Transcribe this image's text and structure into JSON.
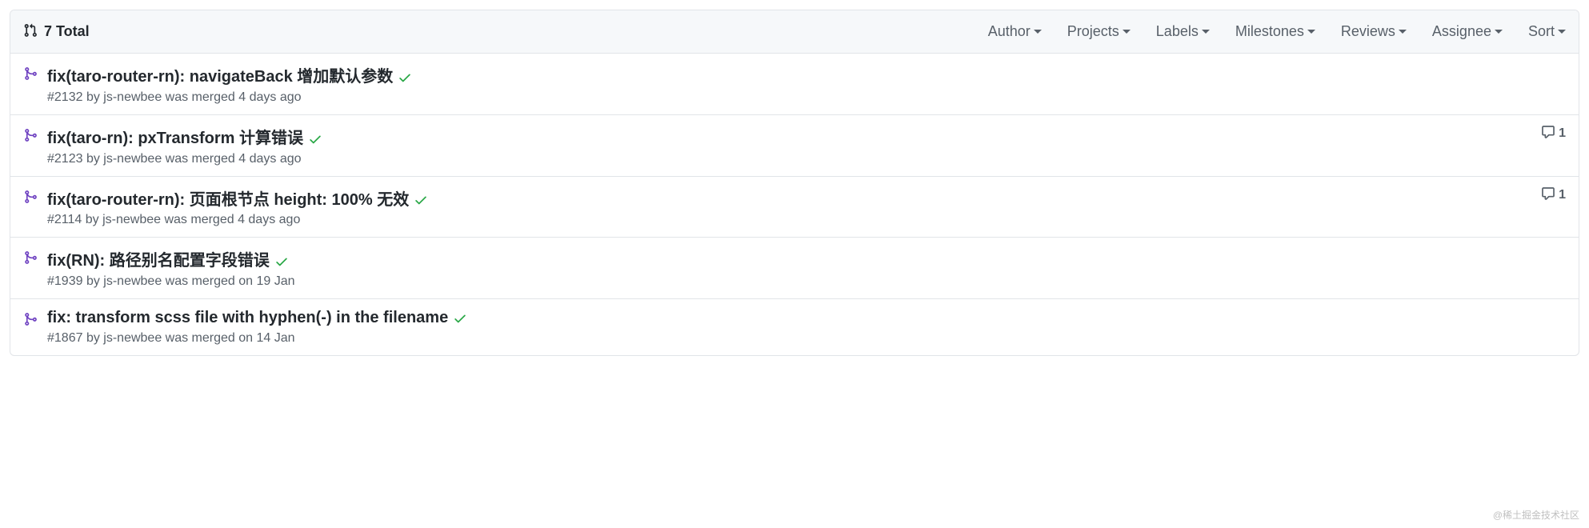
{
  "header": {
    "total_label": "7 Total",
    "filters": [
      {
        "label": "Author"
      },
      {
        "label": "Projects"
      },
      {
        "label": "Labels"
      },
      {
        "label": "Milestones"
      },
      {
        "label": "Reviews"
      },
      {
        "label": "Assignee"
      },
      {
        "label": "Sort"
      }
    ]
  },
  "pull_requests": [
    {
      "title": "fix(taro-router-rn): navigateBack 增加默认参数",
      "meta": "#2132 by js-newbee was merged 4 days ago",
      "comments": null
    },
    {
      "title": "fix(taro-rn): pxTransform 计算错误",
      "meta": "#2123 by js-newbee was merged 4 days ago",
      "comments": "1"
    },
    {
      "title": "fix(taro-router-rn): 页面根节点 height: 100% 无效",
      "meta": "#2114 by js-newbee was merged 4 days ago",
      "comments": "1"
    },
    {
      "title": "fix(RN): 路径别名配置字段错误",
      "meta": "#1939 by js-newbee was merged on 19 Jan",
      "comments": null
    },
    {
      "title": "fix: transform scss file with hyphen(-) in the filename",
      "meta": "#1867 by js-newbee was merged on 14 Jan",
      "comments": null
    }
  ],
  "watermark": "@稀土掘金技术社区"
}
